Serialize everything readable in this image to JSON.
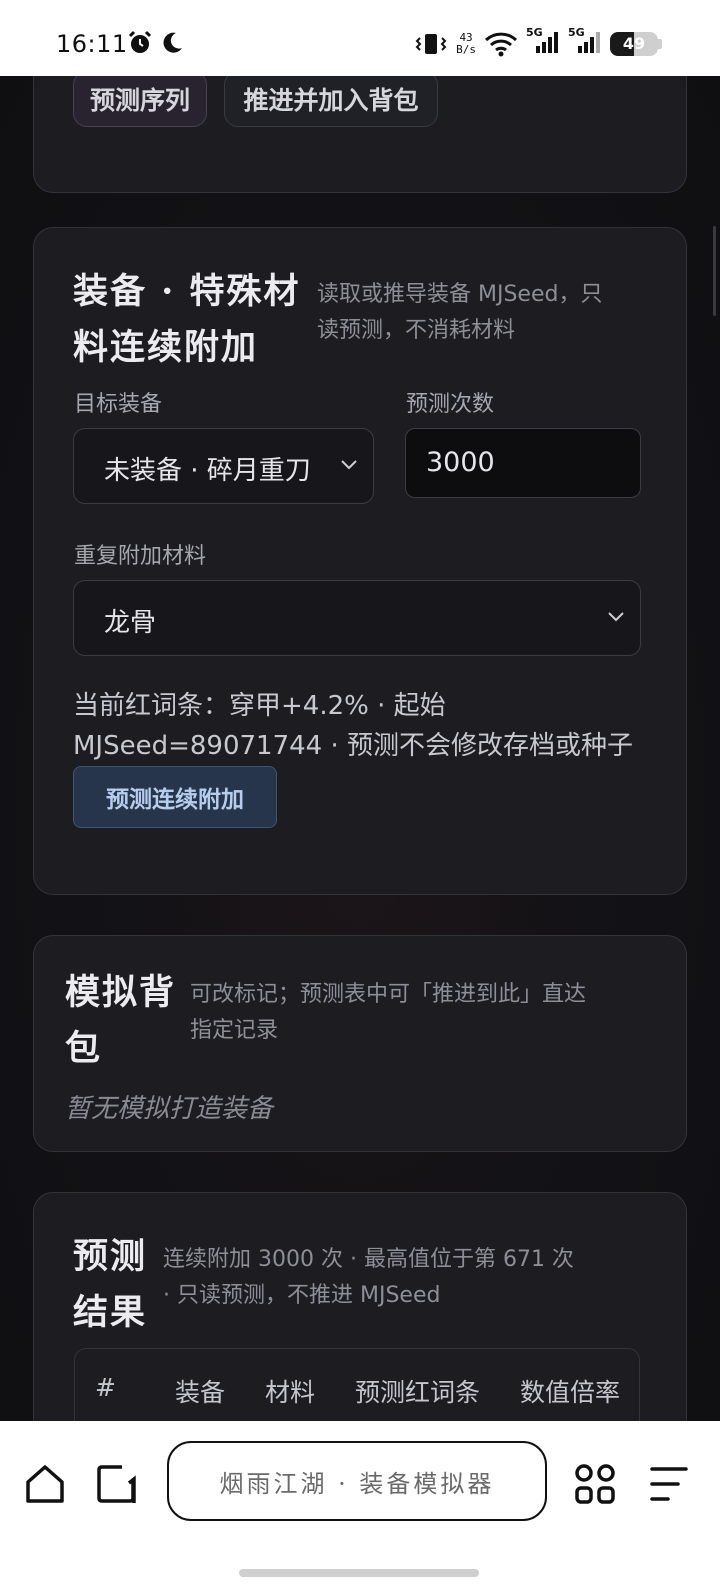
{
  "status_bar": {
    "time": "16:11",
    "net_speed_value": "43",
    "net_speed_unit": "B/s",
    "signal_1": "5G",
    "signal_2": "5G",
    "battery": "49"
  },
  "top_card": {
    "predict_sequence_button": "预测序列",
    "advance_add_bag_button": "推进并加入背包"
  },
  "equip_card": {
    "title": "装备 · 特殊材料连续附加",
    "title_line1": "装备 · 特殊材",
    "title_line2": "料连续附加",
    "description_line1": "读取或推导装备 MJSeed，只",
    "description_line2": "读预测，不消耗材料",
    "target_label": "目标装备",
    "target_value": "未装备 · 碎月重刀",
    "count_label": "预测次数",
    "count_value": "3000",
    "material_label": "重复附加材料",
    "material_value": "龙骨",
    "info_line1": "当前红词条：穿甲+4.2% · 起始",
    "info_line2": "MJSeed=89071744 · 预测不会修改存档或种子",
    "predict_button": "预测连续附加"
  },
  "bag_card": {
    "title_line1": "模拟背",
    "title_line2": "包",
    "description_line1": "可改标记；预测表中可「推进到此」直达",
    "description_line2": "指定记录",
    "empty_text": "暂无模拟打造装备"
  },
  "result_card": {
    "title_line1": "预测",
    "title_line2": "结果",
    "description_line1": "连续附加 3000 次 · 最高值位于第 671 次",
    "description_line2": "· 只读预测，不推进 MJSeed",
    "columns": [
      "#",
      "装备",
      "材料",
      "预测红词条",
      "数值倍率"
    ]
  },
  "bottom_nav": {
    "url_text": "烟雨江湖 · 装备模拟器",
    "icons": [
      "home-icon",
      "tabs-icon",
      "apps-icon",
      "menu-icon"
    ]
  }
}
